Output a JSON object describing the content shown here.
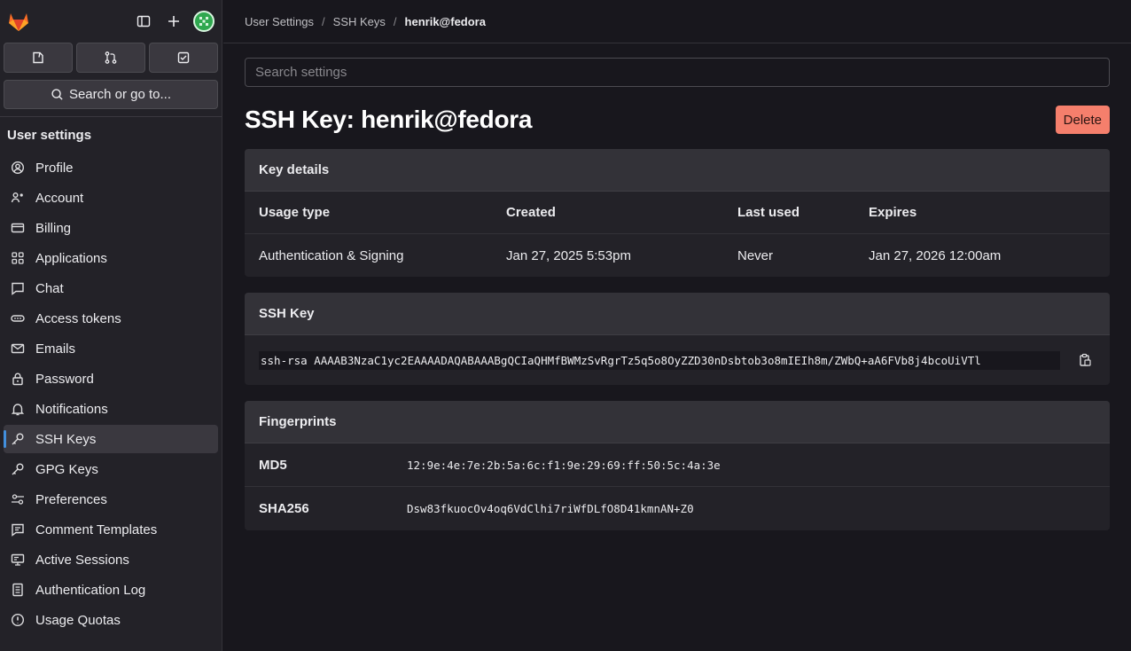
{
  "topbar": {
    "logo": "gitlab-logo",
    "sidebar_toggle": "sidebar-toggle-icon",
    "new": "plus-icon",
    "avatar": "user-avatar"
  },
  "quick": [
    {
      "name": "issues-icon"
    },
    {
      "name": "merge-requests-icon"
    },
    {
      "name": "todo-icon"
    }
  ],
  "search": {
    "label": "Search or go to..."
  },
  "sidebar": {
    "title": "User settings",
    "items": [
      {
        "label": "Profile",
        "icon": "profile-icon"
      },
      {
        "label": "Account",
        "icon": "account-icon"
      },
      {
        "label": "Billing",
        "icon": "billing-icon"
      },
      {
        "label": "Applications",
        "icon": "applications-icon"
      },
      {
        "label": "Chat",
        "icon": "chat-icon"
      },
      {
        "label": "Access tokens",
        "icon": "token-icon"
      },
      {
        "label": "Emails",
        "icon": "mail-icon"
      },
      {
        "label": "Password",
        "icon": "lock-icon"
      },
      {
        "label": "Notifications",
        "icon": "bell-icon"
      },
      {
        "label": "SSH Keys",
        "icon": "key-icon",
        "active": true
      },
      {
        "label": "GPG Keys",
        "icon": "key-icon"
      },
      {
        "label": "Preferences",
        "icon": "preferences-icon"
      },
      {
        "label": "Comment Templates",
        "icon": "comment-icon"
      },
      {
        "label": "Active Sessions",
        "icon": "monitor-icon"
      },
      {
        "label": "Authentication Log",
        "icon": "log-icon"
      },
      {
        "label": "Usage Quotas",
        "icon": "quota-icon"
      }
    ]
  },
  "breadcrumb": [
    "User Settings",
    "SSH Keys",
    "henrik@fedora"
  ],
  "search_settings": {
    "placeholder": "Search settings"
  },
  "page": {
    "title": "SSH Key: henrik@fedora",
    "delete_label": "Delete"
  },
  "key_details": {
    "header": "Key details",
    "columns": [
      "Usage type",
      "Created",
      "Last used",
      "Expires"
    ],
    "values": [
      "Authentication & Signing",
      "Jan 27, 2025 5:53pm",
      "Never",
      "Jan 27, 2026 12:00am"
    ]
  },
  "ssh_key": {
    "header": "SSH Key",
    "value": "ssh-rsa AAAAB3NzaC1yc2EAAAADAQABAAABgQCIaQHMfBWMzSvRgrTz5q5o8OyZZD30nDsbtob3o8mIEIh8m/ZWbQ+aA6FVb8j4bcoUiVTl"
  },
  "fingerprints": {
    "header": "Fingerprints",
    "rows": [
      {
        "label": "MD5",
        "value": "12:9e:4e:7e:2b:5a:6c:f1:9e:29:69:ff:50:5c:4a:3e"
      },
      {
        "label": "SHA256",
        "value": "Dsw83fkuocOv4oq6VdClhi7riWfDLfO8D41kmnAN+Z0"
      }
    ]
  },
  "colors": {
    "accent": "#428fdc",
    "danger": "#f57f6c",
    "bg": "#18171d",
    "sidebar": "#232228"
  }
}
